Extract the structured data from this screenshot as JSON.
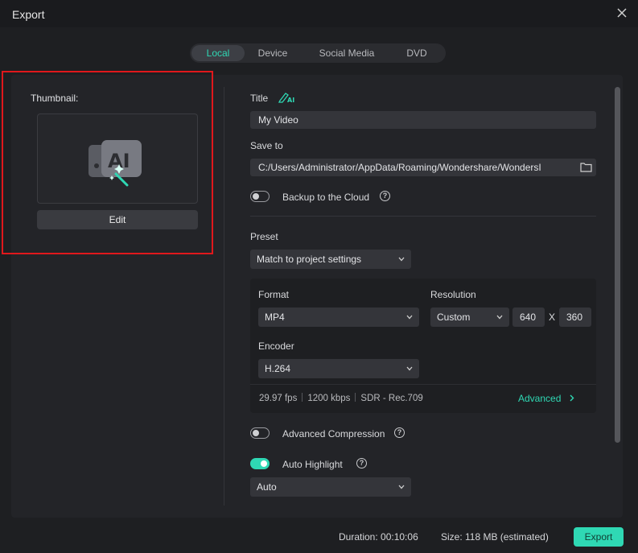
{
  "window": {
    "title": "Export"
  },
  "tabs": [
    {
      "label": "Local",
      "active": true
    },
    {
      "label": "Device",
      "active": false
    },
    {
      "label": "Social Media",
      "active": false
    },
    {
      "label": "DVD",
      "active": false
    }
  ],
  "thumbnail": {
    "label": "Thumbnail:",
    "edit_label": "Edit",
    "icon": "ai-image-icon"
  },
  "form": {
    "title_label": "Title",
    "title_value": "My Video",
    "save_to_label": "Save to",
    "save_to_value": "C:/Users/Administrator/AppData/Roaming/Wondershare/WondersI",
    "backup_label": "Backup to the Cloud",
    "backup_on": false,
    "preset_label": "Preset",
    "preset_value": "Match to project settings",
    "format_label": "Format",
    "format_value": "MP4",
    "resolution_label": "Resolution",
    "resolution_value": "Custom",
    "res_width": "640",
    "res_x": "X",
    "res_height": "360",
    "encoder_label": "Encoder",
    "encoder_value": "H.264",
    "fps": "29.97 fps",
    "bitrate": "1200 kbps",
    "color": "SDR - Rec.709",
    "advanced_label": "Advanced",
    "adv_compression_label": "Advanced Compression",
    "adv_compression_on": false,
    "auto_highlight_label": "Auto Highlight",
    "auto_highlight_on": true,
    "auto_highlight_value": "Auto"
  },
  "footer": {
    "duration": "Duration: 00:10:06",
    "size": "Size:  118 MB (estimated)",
    "export_label": "Export"
  },
  "colors": {
    "accent": "#2fd8b4",
    "highlight_border": "#e0181c"
  }
}
